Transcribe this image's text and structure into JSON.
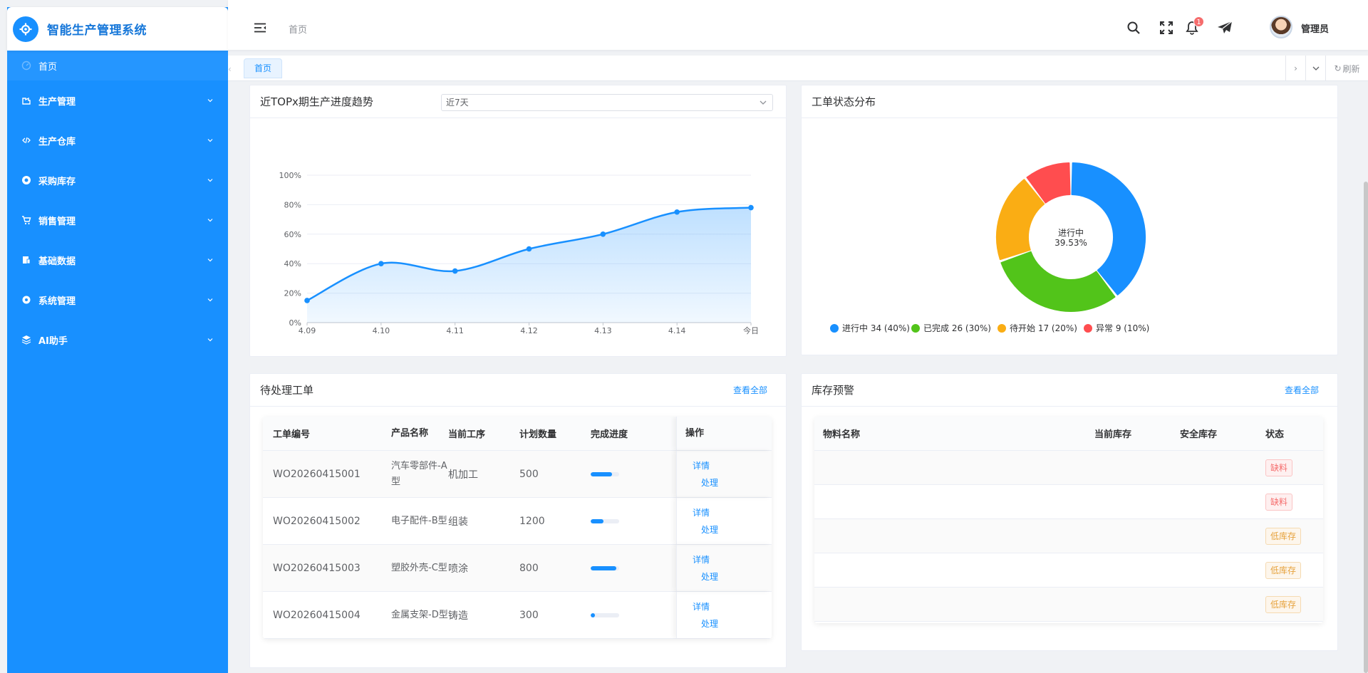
{
  "app": {
    "title": "智能生产管理系统"
  },
  "sidebar": {
    "home": "首页",
    "items": [
      {
        "label": "生产管理",
        "icon": "factory-icon"
      },
      {
        "label": "生产仓库",
        "icon": "code-icon"
      },
      {
        "label": "采购库存",
        "icon": "chrome-icon"
      },
      {
        "label": "销售管理",
        "icon": "cart-icon"
      },
      {
        "label": "基础数据",
        "icon": "database-icon"
      },
      {
        "label": "系统管理",
        "icon": "gear-icon"
      },
      {
        "label": "AI助手",
        "icon": "robot-icon"
      }
    ]
  },
  "header": {
    "breadcrumb": "首页",
    "notification_count": "1",
    "username": "管理员"
  },
  "tabs": {
    "home": "首页",
    "refresh": "刷新"
  },
  "trend_card": {
    "title": "近TOPx期生产进度趋势",
    "range_selected": "近7天"
  },
  "status_card": {
    "title": "工单状态分布",
    "center_label": "进行中",
    "center_value": "39.53%",
    "legend": [
      {
        "label": "进行中 34 (40%)",
        "color": "#1890ff"
      },
      {
        "label": "已完成 26 (30%)",
        "color": "#52c41a"
      },
      {
        "label": "待开始 17 (20%)",
        "color": "#faad14"
      },
      {
        "label": "异常 9 (10%)",
        "color": "#ff4d4f"
      }
    ]
  },
  "pending": {
    "title": "待处理工单",
    "view_all": "查看全部",
    "columns": [
      "工单编号",
      "产品名称",
      "当前工序",
      "计划数量",
      "完成进度",
      "操作"
    ],
    "rows": [
      {
        "id": "WO20260415001",
        "product": "汽车零部件-A型",
        "process": "机加工",
        "qty": "500",
        "progress": 0.75
      },
      {
        "id": "WO20260415002",
        "product": "电子配件-B型",
        "process": "组装",
        "qty": "1200",
        "progress": 0.45
      },
      {
        "id": "WO20260415003",
        "product": "塑胶外壳-C型",
        "process": "喷涂",
        "qty": "800",
        "progress": 0.9
      },
      {
        "id": "WO20260415004",
        "product": "金属支架-D型",
        "process": "铸造",
        "qty": "300",
        "progress": 0.15
      }
    ],
    "action_detail": "详情",
    "action_handle": "处理"
  },
  "inventory": {
    "title": "库存预警",
    "view_all": "查看全部",
    "columns": [
      "物料名称",
      "当前库存",
      "安全库存",
      "状态"
    ],
    "rows": [
      {
        "status": "缺料",
        "level": "red"
      },
      {
        "status": "缺料",
        "level": "red"
      },
      {
        "status": "低库存",
        "level": "orange"
      },
      {
        "status": "低库存",
        "level": "orange"
      },
      {
        "status": "低库存",
        "level": "orange"
      }
    ]
  },
  "chart_data": [
    {
      "type": "area",
      "x": [
        "4.09",
        "4.10",
        "4.11",
        "4.12",
        "4.13",
        "4.14",
        "今日"
      ],
      "values": [
        15,
        40,
        35,
        50,
        60,
        75,
        78
      ],
      "y_ticks": [
        "0%",
        "20%",
        "40%",
        "60%",
        "80%",
        "100%"
      ],
      "ylim": [
        0,
        100
      ],
      "grid": true,
      "color": "#1890ff"
    },
    {
      "type": "pie",
      "categories": [
        "进行中",
        "已完成",
        "待开始",
        "异常"
      ],
      "values": [
        34,
        26,
        17,
        9
      ],
      "colors": [
        "#1890ff",
        "#52c41a",
        "#faad14",
        "#ff4d4f"
      ],
      "legend": "bottom"
    }
  ]
}
